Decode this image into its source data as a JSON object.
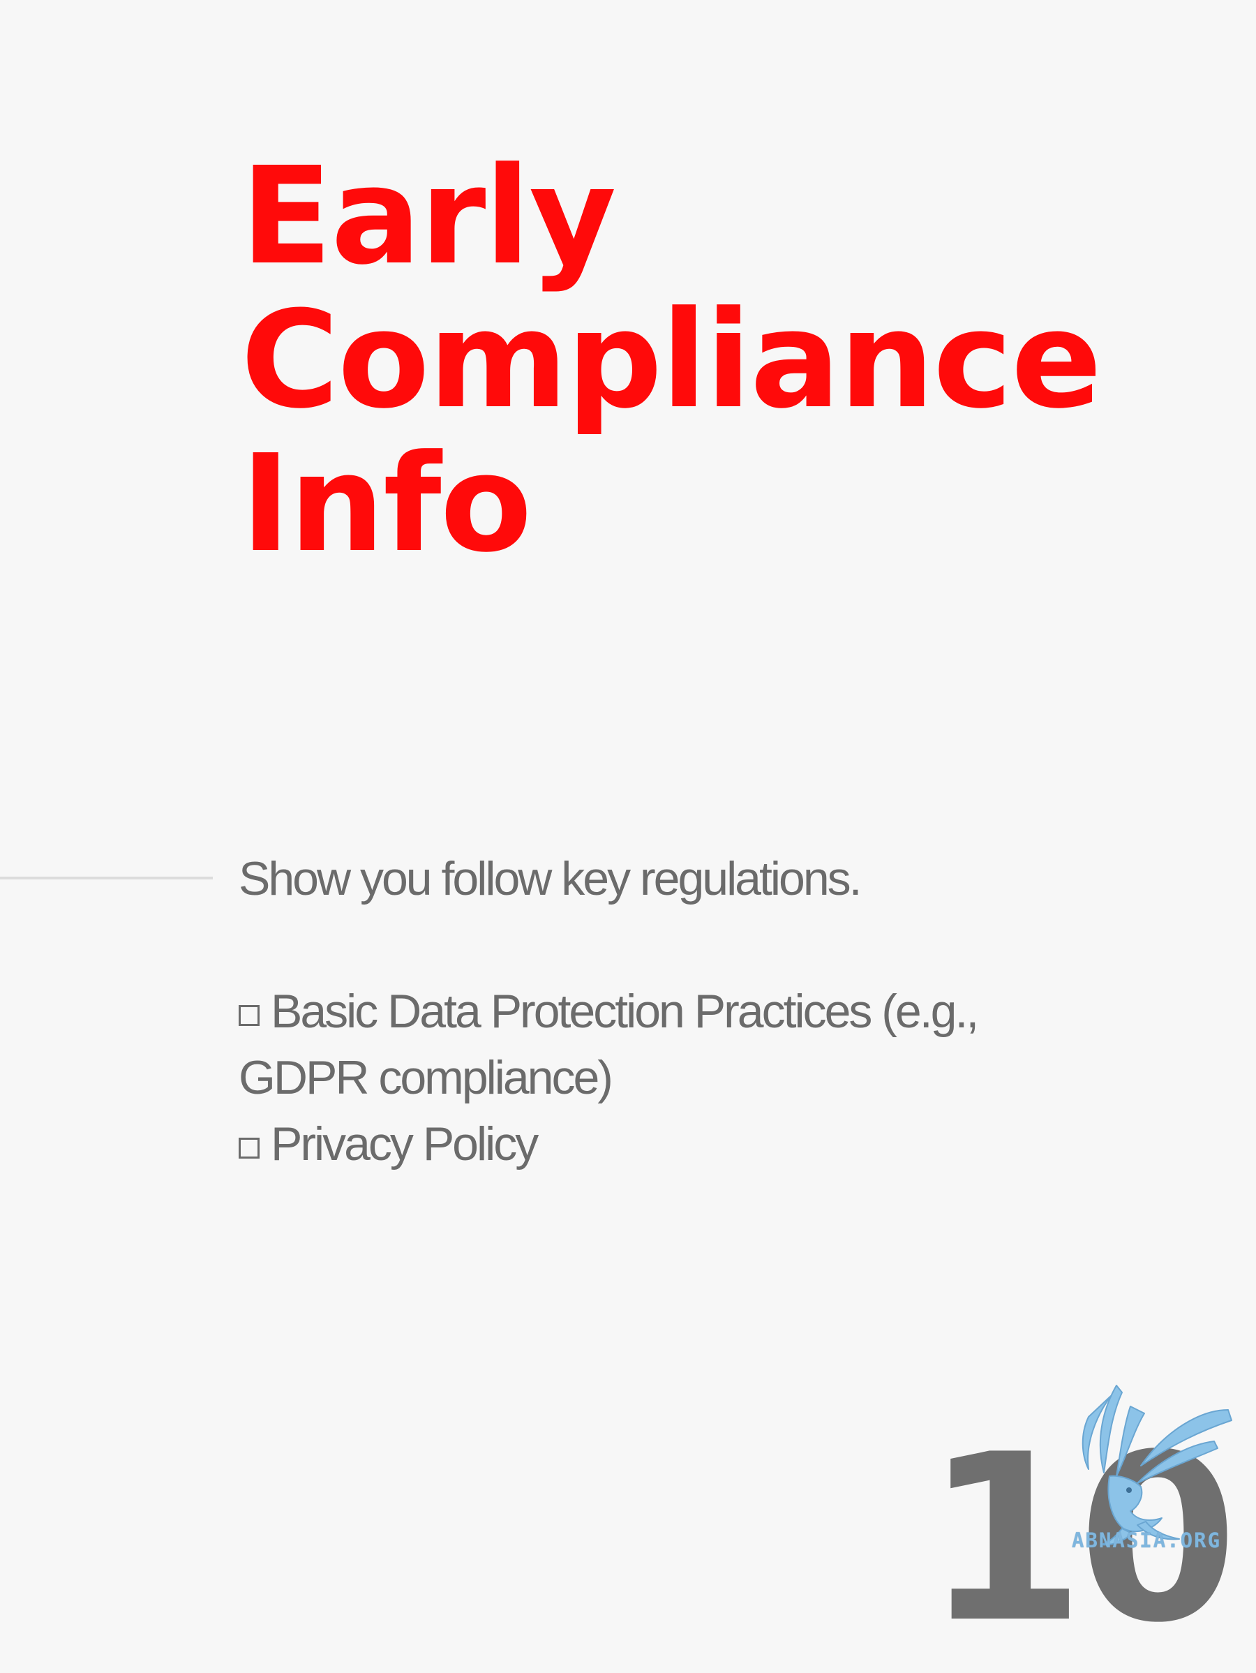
{
  "title": {
    "lines": [
      "Early",
      "Compliance",
      "Info"
    ]
  },
  "body": {
    "intro": "Show you follow key regulations.",
    "checklist": [
      "Basic Data Protection Practices (e.g., GDPR compliance)",
      "Privacy Policy"
    ]
  },
  "page_number": "10",
  "logo": {
    "text": "ABNASIA.ORG",
    "color": "#7fb6de"
  },
  "colors": {
    "title": "#ff0a0a",
    "body": "#6b6b6b",
    "background": "#f7f7f7"
  }
}
